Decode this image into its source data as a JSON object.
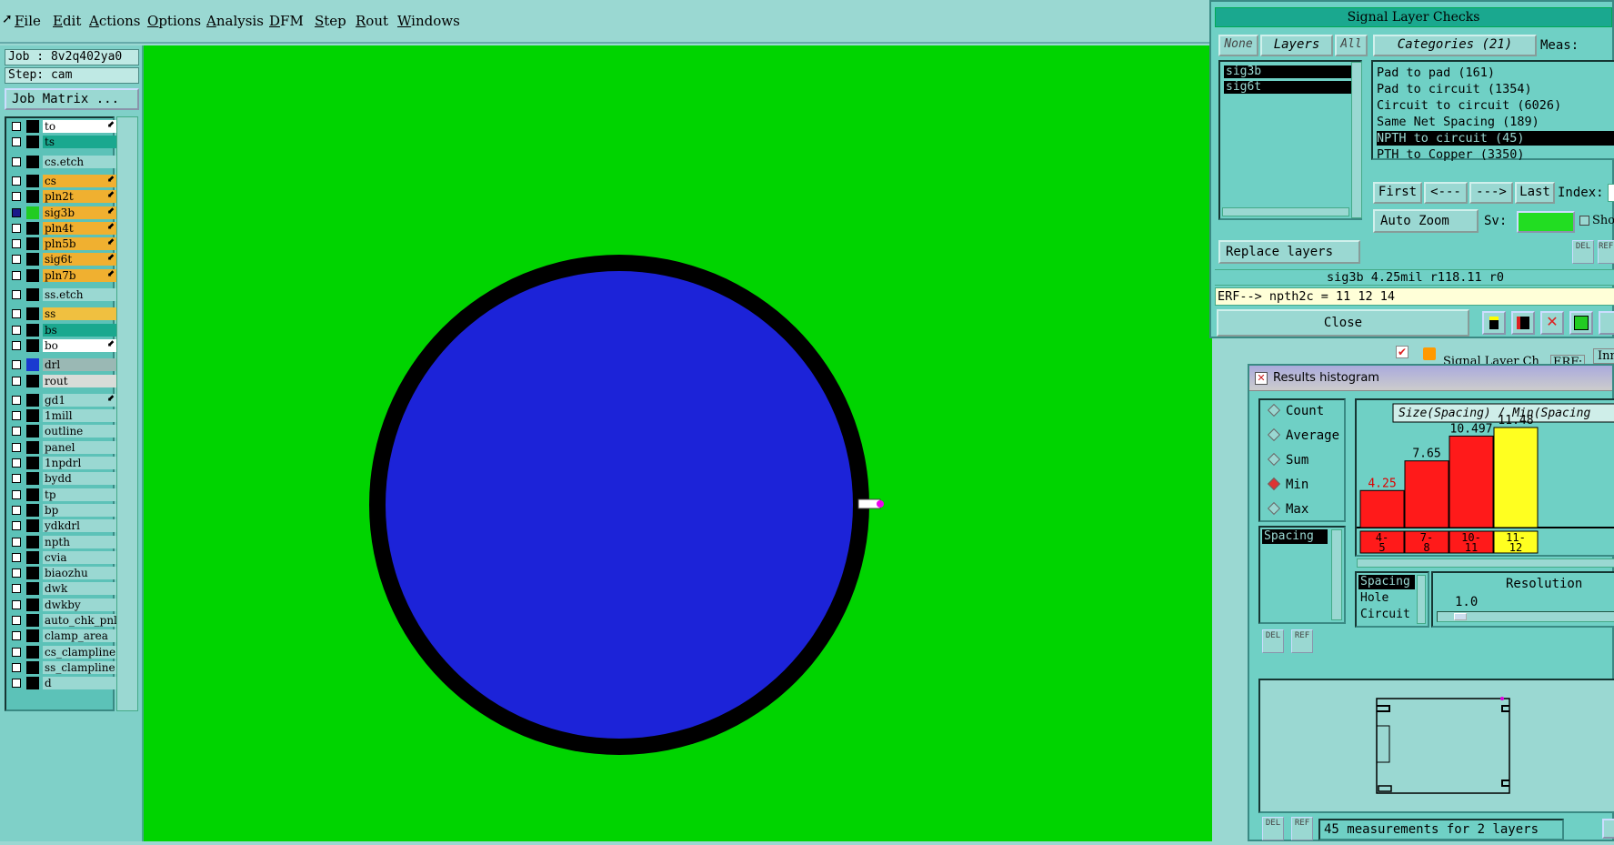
{
  "menu": [
    "File",
    "Edit",
    "Actions",
    "Options",
    "Analysis",
    "DFM",
    "Step",
    "Rout",
    "Windows"
  ],
  "job": {
    "label": "Job : 8v2q402ya0",
    "step": "Step: cam",
    "matrix_button": "Job Matrix ..."
  },
  "layers": [
    {
      "name": "to",
      "color": "#ffffff",
      "sw": "#000000",
      "arrow": true
    },
    {
      "name": "ts",
      "color": "#1aa88f",
      "sw": "#000000"
    },
    {
      "name": "cs.etch",
      "color": "#9ad8d2",
      "sw": "#000000",
      "gap": true
    },
    {
      "name": "cs",
      "color": "#f0b030",
      "sw": "#000000",
      "arrow": true,
      "gap": true
    },
    {
      "name": "pln2t",
      "color": "#f0b030",
      "sw": "#000000",
      "arrow": true
    },
    {
      "name": "sig3b",
      "color": "#f0b030",
      "sw": "#22cc22",
      "arrow": true,
      "checked": true
    },
    {
      "name": "pln4t",
      "color": "#f0b030",
      "sw": "#000000",
      "arrow": true
    },
    {
      "name": "pln5b",
      "color": "#f0b030",
      "sw": "#000000",
      "arrow": true
    },
    {
      "name": "sig6t",
      "color": "#f0b030",
      "sw": "#000000",
      "arrow": true
    },
    {
      "name": "pln7b",
      "color": "#f0b030",
      "sw": "#000000",
      "arrow": true
    },
    {
      "name": "ss.etch",
      "color": "#9ad8d2",
      "sw": "#000000",
      "gap": true
    },
    {
      "name": "ss",
      "color": "#f0c040",
      "sw": "#000000",
      "gap": true
    },
    {
      "name": "bs",
      "color": "#1aa88f",
      "sw": "#000000"
    },
    {
      "name": "bo",
      "color": "#ffffff",
      "sw": "#000000",
      "arrow": true
    },
    {
      "name": "drl",
      "color": "#9ab8b4",
      "sw": "#1a3ad0",
      "gap": true
    },
    {
      "name": "rout",
      "color": "#d8dcd8",
      "sw": "#000000"
    },
    {
      "name": "gd1",
      "color": "#9ad8d2",
      "sw": "#000000",
      "arrow": true,
      "gap": true
    },
    {
      "name": "1mill",
      "color": "#9ad8d2",
      "sw": "#000000"
    },
    {
      "name": "outline",
      "color": "#9ad8d2",
      "sw": "#000000"
    },
    {
      "name": "panel",
      "color": "#9ad8d2",
      "sw": "#000000"
    },
    {
      "name": "1npdrl",
      "color": "#9ad8d2",
      "sw": "#000000"
    },
    {
      "name": "bydd",
      "color": "#9ad8d2",
      "sw": "#000000"
    },
    {
      "name": "tp",
      "color": "#9ad8d2",
      "sw": "#000000"
    },
    {
      "name": "bp",
      "color": "#9ad8d2",
      "sw": "#000000"
    },
    {
      "name": "ydkdrl",
      "color": "#9ad8d2",
      "sw": "#000000"
    },
    {
      "name": "npth",
      "color": "#9ad8d2",
      "sw": "#000000"
    },
    {
      "name": "cvia",
      "color": "#9ad8d2",
      "sw": "#000000"
    },
    {
      "name": "biaozhu",
      "color": "#9ad8d2",
      "sw": "#000000"
    },
    {
      "name": "dwk",
      "color": "#9ad8d2",
      "sw": "#000000"
    },
    {
      "name": "dwkby",
      "color": "#9ad8d2",
      "sw": "#000000"
    },
    {
      "name": "auto_chk_pnl",
      "color": "#9ad8d2",
      "sw": "#000000"
    },
    {
      "name": "clamp_area",
      "color": "#9ad8d2",
      "sw": "#000000"
    },
    {
      "name": "cs_clampline",
      "color": "#9ad8d2",
      "sw": "#000000"
    },
    {
      "name": "ss_clampline",
      "color": "#9ad8d2",
      "sw": "#000000"
    },
    {
      "name": "d",
      "color": "#9ad8d2",
      "sw": "#000000"
    }
  ],
  "signal": {
    "title": "Signal Layer Checks",
    "none": "None",
    "layers": "Layers",
    "all": "All",
    "categories": "Categories (21)",
    "meas": "Meas:",
    "layer_items": [
      "sig3b",
      "sig6t"
    ],
    "cat_items": [
      "Pad to pad (161)",
      "Pad to circuit (1354)",
      "Circuit to circuit (6026)",
      "Same Net Spacing (189)",
      "NPTH to circuit (45)",
      "PTH to Copper (3350)"
    ],
    "first": "First",
    "prev": "<---",
    "next": "--->",
    "last": "Last",
    "index": "Index:",
    "autozoom": "Auto Zoom",
    "sv": "Sv:",
    "show": "Show",
    "replace": "Replace layers",
    "status": "sig3b 4.25mil  r118.11  r0",
    "erf": "ERF--> npth2c = 11 12 14",
    "close": "Close",
    "del": "DEL",
    "ref": "REF",
    "tab_label": "Signal Layer Ch",
    "tab_erf": "ERF:",
    "tab_inn": "Inn"
  },
  "hist": {
    "title": "Results histogram",
    "radios": [
      "Count",
      "Average",
      "Sum",
      "Min",
      "Max"
    ],
    "selected": "Min",
    "left_list": [
      "Spacing"
    ],
    "chart_title": "Size(Spacing) / Min(Spacing)",
    "bottom_list": [
      "Spacing",
      "Hole",
      "Circuit"
    ],
    "resolution": "Resolution",
    "res_value": "1.0",
    "footer": "45 measurements for 2 layers",
    "del": "DEL",
    "ref": "REF"
  },
  "chart_data": {
    "type": "bar",
    "categories": [
      "4-\n5",
      "7-\n8",
      "10-\n11",
      "11-\n12"
    ],
    "values": [
      4.25,
      7.65,
      10.497,
      11.48
    ],
    "value_labels": [
      "4.25",
      "7.65",
      "10.497",
      "11.48"
    ],
    "colors": [
      "#ff1a1a",
      "#ff1a1a",
      "#ff1a1a",
      "#ffff20"
    ],
    "title": "Size(Spacing) / Min(Spacing"
  }
}
